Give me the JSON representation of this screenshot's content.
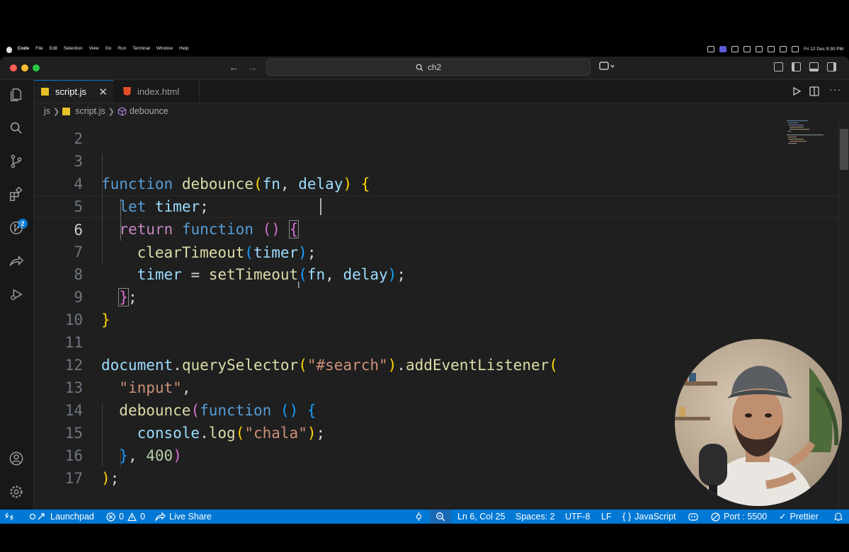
{
  "menubar": {
    "app": "Code",
    "items": [
      "File",
      "Edit",
      "Selection",
      "View",
      "Go",
      "Run",
      "Terminal",
      "Window",
      "Help"
    ],
    "clock": "Fri 12 Dec  9:30 PM"
  },
  "titlebar": {
    "search_text": "ch2",
    "search_icon": "search-icon",
    "back_icon": "arrow-left-icon",
    "forward_icon": "arrow-right-icon"
  },
  "activity_bar": {
    "items": [
      "explorer-icon",
      "search-icon",
      "source-control-icon",
      "extensions-icon",
      "git-graph-icon",
      "live-share-icon",
      "run-debug-icon",
      "account-icon",
      "settings-gear-icon"
    ],
    "extensions_badge": "2"
  },
  "tabs": [
    {
      "label": "script.js",
      "active": true
    },
    {
      "label": "index.html",
      "active": false
    }
  ],
  "breadcrumb": {
    "folder": "js",
    "file": "script.js",
    "symbol": "debounce"
  },
  "editor": {
    "partial_line_number": "2",
    "current_line": 6
  },
  "statusbar": {
    "launchpad": "Launchpad",
    "errors": "0",
    "warnings": "0",
    "live_share": "Live Share",
    "position": "Ln 6, Col 25",
    "spaces": "Spaces: 2",
    "encoding": "UTF-8",
    "eol": "LF",
    "language": "JavaScript",
    "port": "Port : 5500",
    "prettier": "Prettier"
  },
  "colors": {
    "accent": "#0078d4",
    "editor_bg": "#1f1f1f",
    "keyword": "#569cd6",
    "function": "#dcdcaa",
    "string": "#ce9178"
  }
}
